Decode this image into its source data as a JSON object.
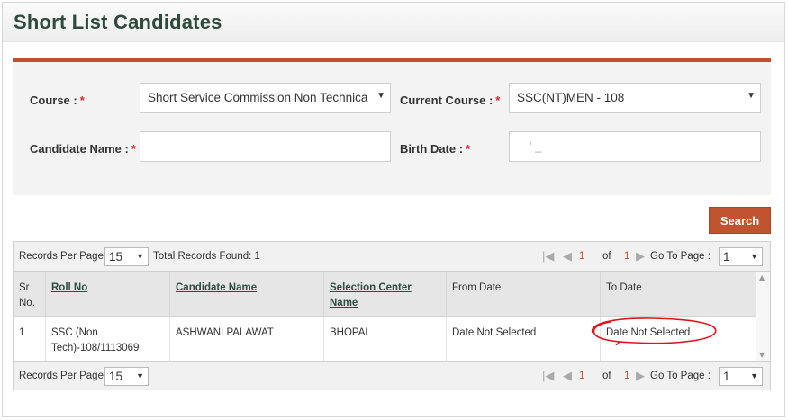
{
  "page": {
    "title": "Short List Candidates"
  },
  "form": {
    "course_label": "Course :",
    "course_value": "Short Service Commission Non Technica",
    "current_course_label": "Current Course :",
    "current_course_value": "SSC(NT)MEN - 108",
    "candidate_name_label": "Candidate Name :",
    "candidate_name_value": "",
    "birth_date_label": "Birth Date :",
    "birth_date_value": "' _",
    "required_mark": "*"
  },
  "search_button": "Search",
  "pager": {
    "records_per_page_label": "Records Per Page :",
    "records_per_page_value": "15",
    "total_records_label": "Total Records Found: 1",
    "current_page": "1",
    "of_label": "of",
    "total_pages": "1",
    "go_to_page_label": "Go To Page :",
    "go_to_page_value": "1"
  },
  "table": {
    "headers": [
      "Sr No.",
      "Roll No",
      "Candidate Name",
      "Selection Center Name",
      "From Date",
      "To Date"
    ],
    "rows": [
      [
        "1",
        "SSC (Non Tech)-108/1113069",
        "ASHWANI PALAWAT",
        "BHOPAL",
        "Date Not Selected",
        "Date Not Selected"
      ]
    ]
  },
  "colors": {
    "accent": "#c1502e",
    "title": "#2e4a3c",
    "annotation": "#e0131a"
  }
}
